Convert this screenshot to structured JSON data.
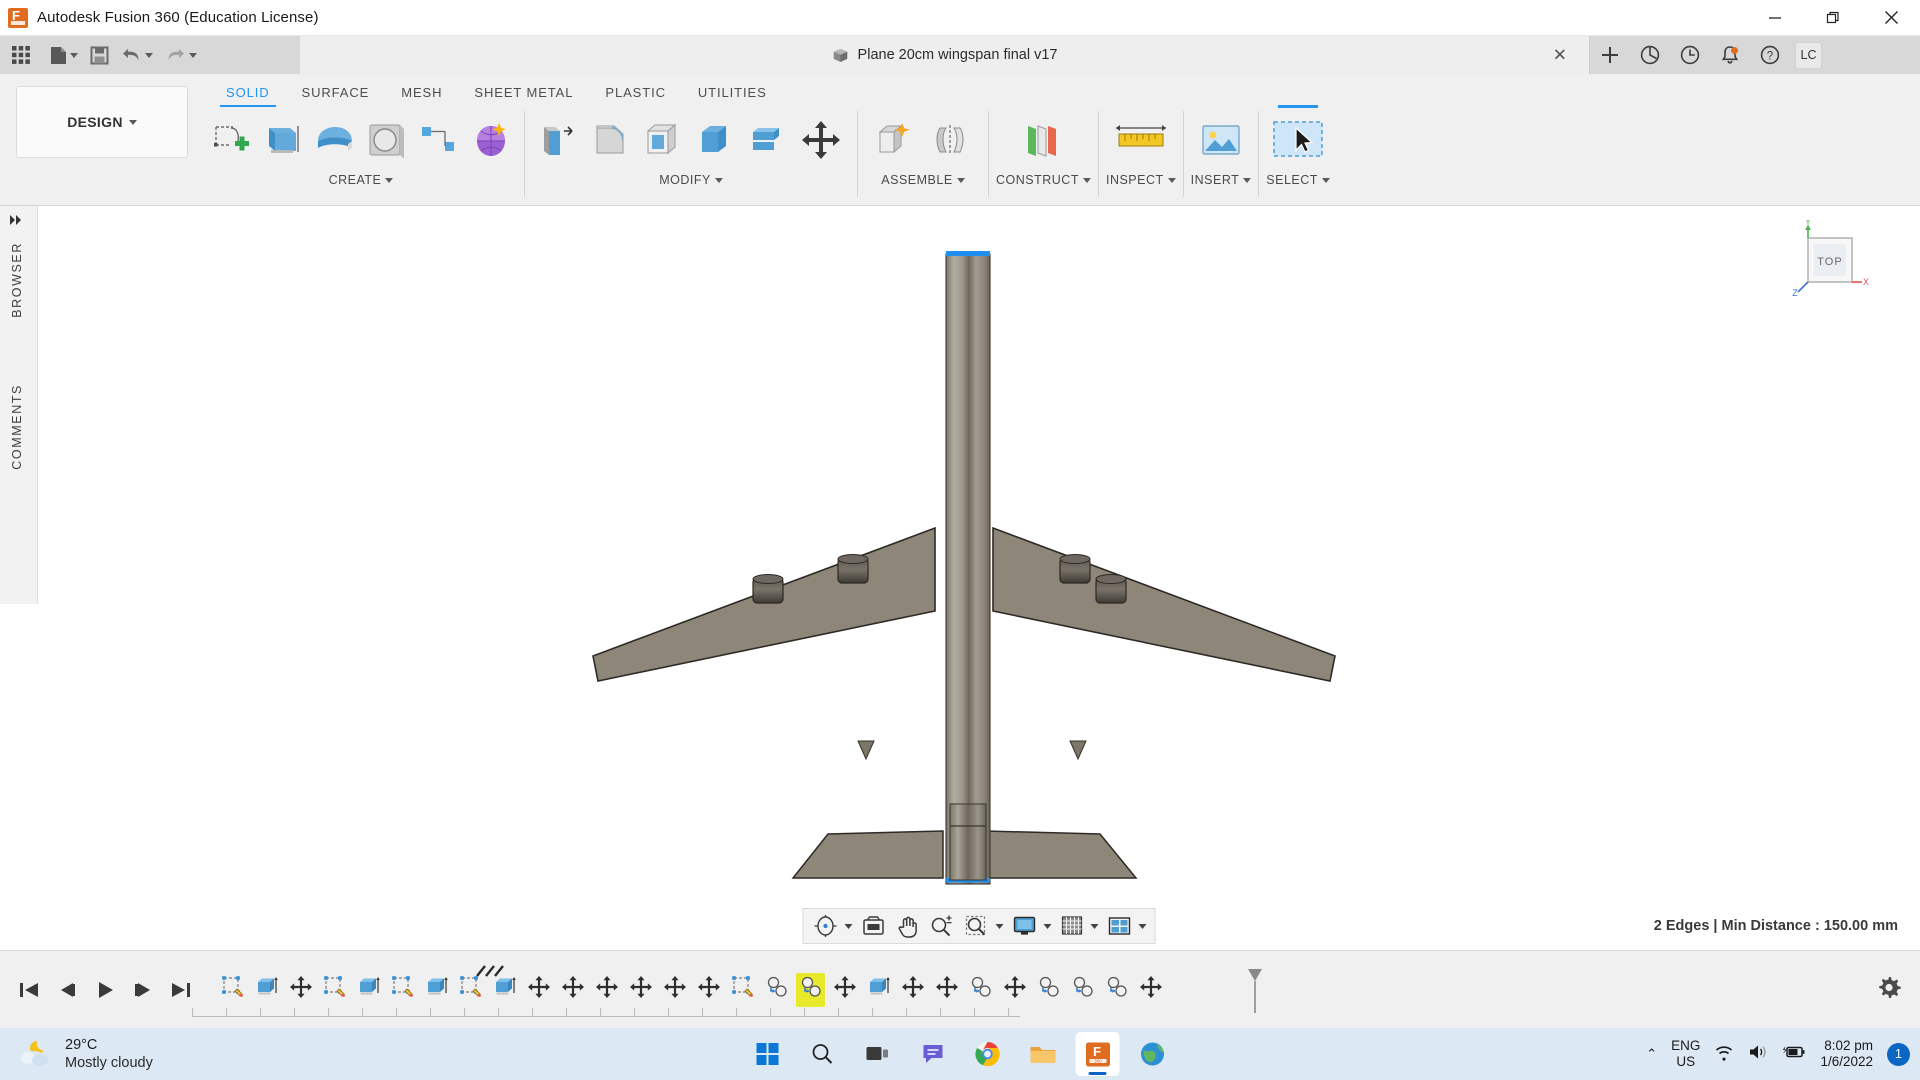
{
  "window": {
    "app_title": "Autodesk Fusion 360 (Education License)",
    "app_icon": "fusion-360-icon",
    "minimize": "minimize-icon",
    "maximize": "restore-icon",
    "close": "close-icon"
  },
  "quick_access": {
    "grid_icon": "app-grid-icon",
    "new_icon": "new-document-icon",
    "save_icon": "save-icon",
    "undo_icon": "undo-icon",
    "redo_icon": "redo-icon",
    "add_tab_icon": "plus-icon",
    "extensions_icon": "extensions-icon",
    "history_icon": "job-status-icon",
    "notifications_icon": "notifications-bell-icon",
    "help_icon": "help-question-icon",
    "account_initials": "LC"
  },
  "document_tab": {
    "label": "Plane 20cm wingspan final v17",
    "icon": "document-cube-icon",
    "close": "close-tab-icon"
  },
  "workspace": {
    "label": "DESIGN",
    "caret": "chevron-down-icon"
  },
  "ribbon": {
    "tabs": [
      {
        "label": "SOLID",
        "active": true
      },
      {
        "label": "SURFACE",
        "active": false
      },
      {
        "label": "MESH",
        "active": false
      },
      {
        "label": "SHEET METAL",
        "active": false
      },
      {
        "label": "PLASTIC",
        "active": false
      },
      {
        "label": "UTILITIES",
        "active": false
      }
    ],
    "panels": [
      {
        "label": "CREATE",
        "has_caret": true,
        "tools": [
          "create-sketch-icon",
          "extrude-icon",
          "revolve-icon",
          "sweep-icon",
          "loft-icon",
          "rib-icon",
          "form-icon"
        ]
      },
      {
        "label": "MODIFY",
        "has_caret": true,
        "tools": [
          "press-pull-icon",
          "fillet-icon",
          "shell-icon",
          "draft-icon",
          "scale-icon",
          "combine-icon",
          "move-copy-icon"
        ]
      },
      {
        "label": "ASSEMBLE",
        "has_caret": true,
        "tools": [
          "new-component-icon",
          "joint-icon"
        ]
      },
      {
        "label": "CONSTRUCT",
        "has_caret": true,
        "tools": [
          "offset-plane-icon"
        ]
      },
      {
        "label": "INSPECT",
        "has_caret": true,
        "tools": [
          "measure-icon"
        ]
      },
      {
        "label": "INSERT",
        "has_caret": true,
        "tools": [
          "insert-canvas-icon"
        ]
      },
      {
        "label": "SELECT",
        "has_caret": true,
        "active": true,
        "tools": [
          "select-cursor-icon"
        ]
      }
    ]
  },
  "left_rail": {
    "collapse_icon": "expand-arrows-icon",
    "browser_label": "BROWSER",
    "comments_label": "COMMENTS"
  },
  "canvas": {
    "view_cube": {
      "face_label": "TOP",
      "axis_x": "X",
      "axis_y": "Y",
      "axis_z": "Z",
      "axis_x_color": "#e8514f",
      "axis_y_color": "#4caf50",
      "axis_z_color": "#3f6fd8"
    },
    "model": {
      "name": "airplane-top-view-model",
      "body_color": "#8a8275",
      "fuselage_light": "#b9b2a6",
      "fuselage_dark": "#6e675c",
      "highlight_edge_color": "#2196f3",
      "engine_color": "#4b4740"
    },
    "status_text": "2 Edges | Min Distance : 150.00 mm"
  },
  "nav_toolbar": {
    "items": [
      {
        "icon": "orbit-icon",
        "caret": true
      },
      {
        "icon": "look-at-icon",
        "caret": false
      },
      {
        "icon": "pan-icon",
        "caret": false
      },
      {
        "icon": "zoom-icon",
        "caret": false
      },
      {
        "icon": "zoom-window-icon",
        "caret": true
      },
      {
        "icon": "display-settings-icon",
        "caret": true
      },
      {
        "icon": "grid-snaps-icon",
        "caret": true
      },
      {
        "icon": "viewports-icon",
        "caret": true
      }
    ]
  },
  "timeline": {
    "playback": [
      "skip-to-start-icon",
      "step-back-icon",
      "play-icon",
      "step-forward-icon",
      "skip-to-end-icon"
    ],
    "features": [
      {
        "icon": "sketch-feature-icon",
        "selected": false
      },
      {
        "icon": "extrude-feature-icon",
        "selected": false
      },
      {
        "icon": "move-feature-icon",
        "selected": false
      },
      {
        "icon": "sketch-feature-icon",
        "selected": false
      },
      {
        "icon": "extrude-feature-icon",
        "selected": false
      },
      {
        "icon": "sketch-feature-icon",
        "selected": false
      },
      {
        "icon": "extrude-feature-icon",
        "selected": false
      },
      {
        "icon": "sketch-feature-icon",
        "selected": false
      },
      {
        "icon": "extrude-feature-icon",
        "selected": false
      },
      {
        "icon": "move-feature-icon",
        "selected": false
      },
      {
        "icon": "move-feature-icon",
        "selected": false
      },
      {
        "icon": "move-feature-icon",
        "selected": false
      },
      {
        "icon": "move-feature-icon",
        "selected": false
      },
      {
        "icon": "move-feature-icon",
        "selected": false
      },
      {
        "icon": "move-feature-icon",
        "selected": false
      },
      {
        "icon": "sketch-feature-icon",
        "selected": false
      },
      {
        "icon": "mirror-feature-icon",
        "selected": false
      },
      {
        "icon": "copy-paste-feature-icon",
        "selected": true
      },
      {
        "icon": "move-feature-icon",
        "selected": false
      },
      {
        "icon": "extrude-feature-icon",
        "selected": false
      },
      {
        "icon": "move-feature-icon",
        "selected": false
      },
      {
        "icon": "move-feature-icon",
        "selected": false
      },
      {
        "icon": "copy-paste-feature-icon",
        "selected": false
      },
      {
        "icon": "move-feature-icon",
        "selected": false
      },
      {
        "icon": "copy-paste-feature-icon",
        "selected": false
      },
      {
        "icon": "copy-paste-feature-icon",
        "selected": false
      },
      {
        "icon": "copy-paste-feature-icon",
        "selected": false
      },
      {
        "icon": "move-feature-icon",
        "selected": false
      }
    ],
    "end_marker_icon": "timeline-end-marker-icon",
    "settings_icon": "gear-icon"
  },
  "taskbar": {
    "weather": {
      "icon": "partly-cloudy-night-icon",
      "temperature": "29°C",
      "condition": "Mostly cloudy"
    },
    "apps": [
      {
        "icon": "windows-start-icon",
        "name": "start-button",
        "active": false
      },
      {
        "icon": "search-icon",
        "name": "search-button",
        "active": false
      },
      {
        "icon": "task-view-icon",
        "name": "task-view-button",
        "active": false
      },
      {
        "icon": "chat-icon",
        "name": "chat-button",
        "active": false
      },
      {
        "icon": "chrome-icon",
        "name": "chrome-button",
        "active": false
      },
      {
        "icon": "file-explorer-icon",
        "name": "explorer-button",
        "active": false
      },
      {
        "icon": "fusion360-icon",
        "name": "fusion-button",
        "active": true
      },
      {
        "icon": "earth-browser-icon",
        "name": "browser-button",
        "active": false
      }
    ],
    "tray": {
      "chevron_icon": "show-hidden-icons-icon",
      "language_line1": "ENG",
      "language_line2": "US",
      "wifi_icon": "wifi-icon",
      "volume_icon": "volume-icon",
      "battery_icon": "battery-charging-icon",
      "time": "8:02 pm",
      "date": "1/6/2022",
      "notification_count": "1"
    }
  }
}
